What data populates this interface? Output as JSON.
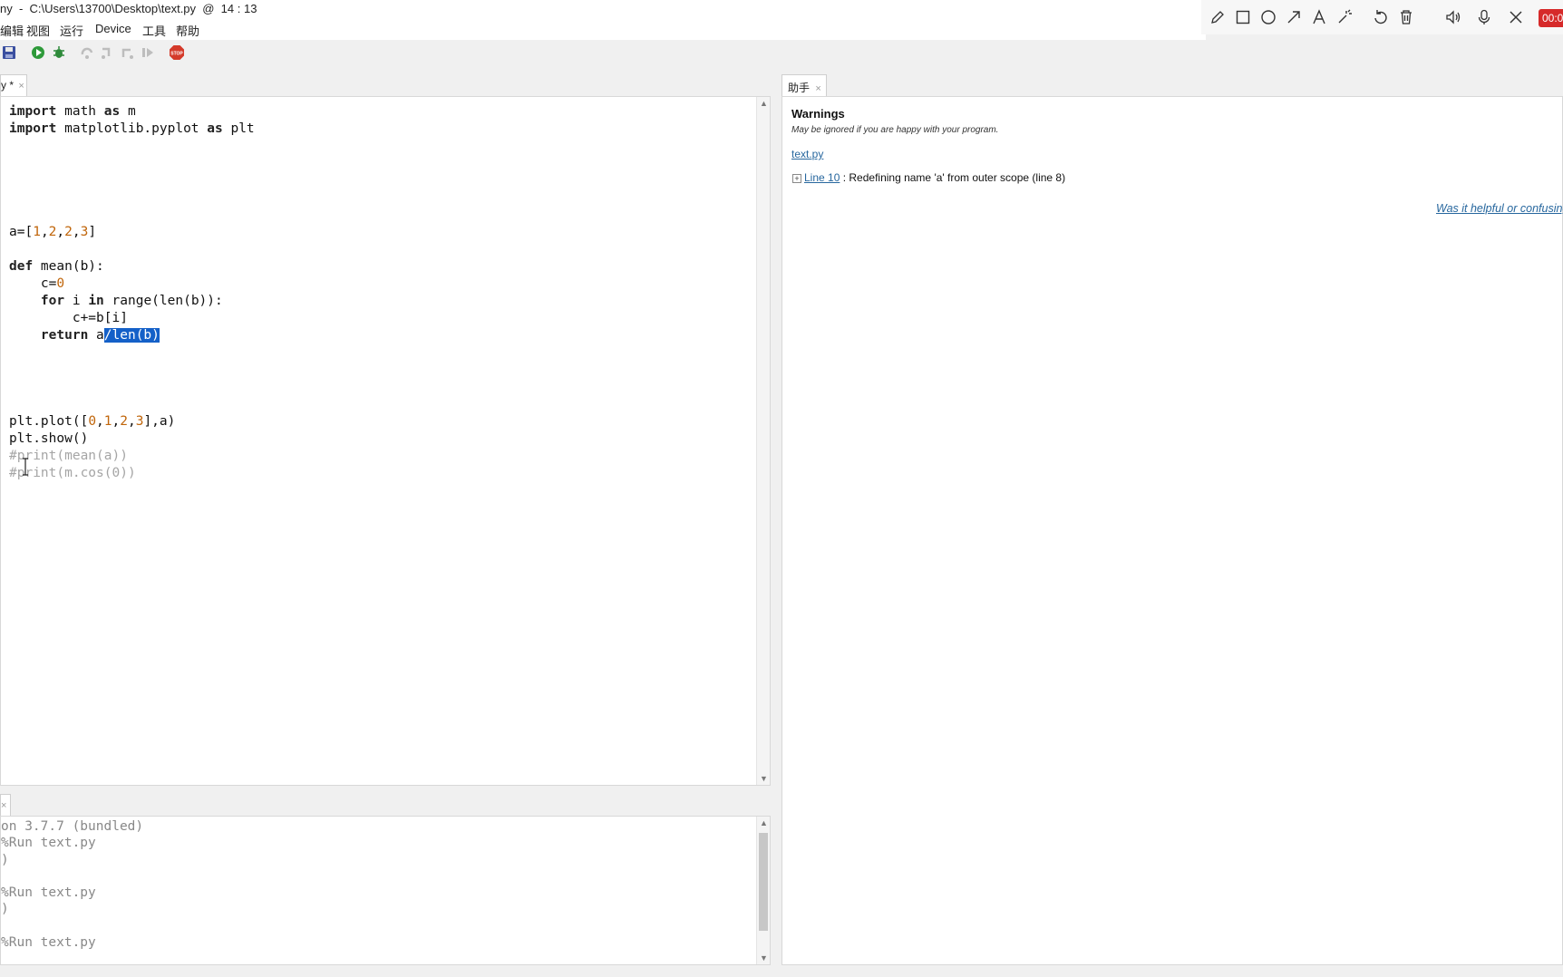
{
  "window": {
    "title": "ny  -  C:\\Users\\13700\\Desktop\\text.py  @  14 : 13"
  },
  "menu": {
    "items": [
      "编辑",
      "视图",
      "运行",
      "Device",
      "工具",
      "帮助"
    ]
  },
  "toolbar": {
    "buttons": [
      "save-icon",
      "run-icon",
      "debug-icon",
      "step-over-icon",
      "step-into-icon",
      "step-out-icon",
      "resume-icon",
      "stop-icon"
    ],
    "stop_label": "STOP"
  },
  "drawing_toolbar": {
    "tools": [
      "pencil-icon",
      "rectangle-icon",
      "circle-icon",
      "arrow-icon",
      "text-icon",
      "magic-wand-icon",
      "undo-icon",
      "trash-icon",
      "speaker-icon",
      "microphone-icon",
      "close-icon"
    ],
    "timer": "00:0"
  },
  "editor": {
    "tab_label": "y *",
    "tab_close": "×",
    "lines": [
      "import math as m",
      "import matplotlib.pyplot as plt",
      "",
      "",
      "",
      "",
      "",
      "a=[1,2,2,3]",
      "",
      "def mean(b):",
      "    c=0",
      "    for i in range(len(b)):",
      "        c+=b[i]",
      "    return a/len(b)",
      "",
      "",
      "",
      "",
      "plt.plot([0,1,2,3],a)",
      "plt.show()",
      "#print(mean(a))",
      "#print(m.cos(0))"
    ],
    "selection": "/len(b)"
  },
  "shell": {
    "tab_close": "×",
    "lines": [
      "on 3.7.7 (bundled)",
      "%Run text.py",
      ")",
      "",
      "%Run text.py",
      ")",
      "",
      "%Run text.py"
    ]
  },
  "assistant": {
    "tab_label": "助手",
    "tab_close": "×",
    "heading": "Warnings",
    "subheading": "May be ignored if you are happy with your program.",
    "file_link": "text.py",
    "warning_link": "Line 10",
    "warning_text": " : Redefining name 'a' from outer scope (line 8)",
    "feedback_link": "Was it helpful or confusing?"
  }
}
